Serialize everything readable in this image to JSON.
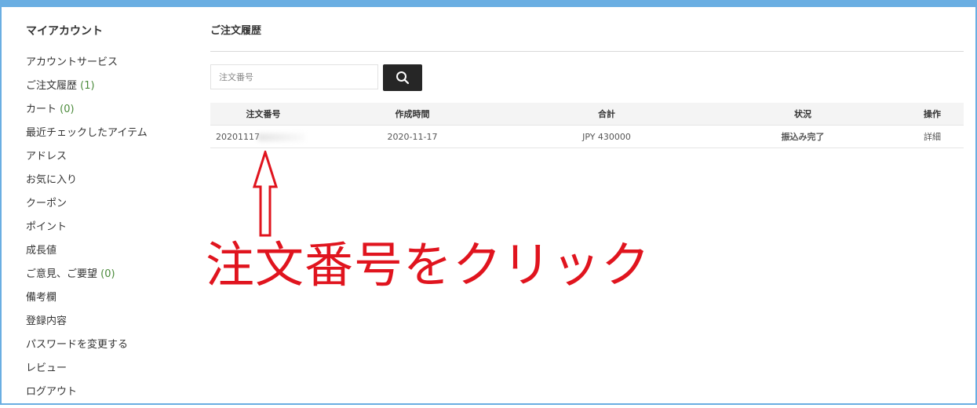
{
  "sidebar": {
    "title": "マイアカウント",
    "items": [
      {
        "label": "アカウントサービス",
        "count": ""
      },
      {
        "label": "ご注文履歴",
        "count": "(1)"
      },
      {
        "label": "カート",
        "count": "(0)"
      },
      {
        "label": "最近チェックしたアイテム",
        "count": ""
      },
      {
        "label": "アドレス",
        "count": ""
      },
      {
        "label": "お気に入り",
        "count": ""
      },
      {
        "label": "クーポン",
        "count": ""
      },
      {
        "label": "ポイント",
        "count": ""
      },
      {
        "label": "成長値",
        "count": ""
      },
      {
        "label": "ご意見、ご要望",
        "count": "(0)"
      },
      {
        "label": "備考欄",
        "count": ""
      },
      {
        "label": "登録内容",
        "count": ""
      },
      {
        "label": "パスワードを変更する",
        "count": ""
      },
      {
        "label": "レビュー",
        "count": ""
      },
      {
        "label": "ログアウト",
        "count": ""
      }
    ]
  },
  "main": {
    "title": "ご注文履歴",
    "search": {
      "placeholder": "注文番号",
      "value": ""
    },
    "table": {
      "headers": [
        "注文番号",
        "作成時間",
        "合計",
        "状況",
        "操作"
      ],
      "rows": [
        {
          "order_number": "20201117",
          "created": "2020-11-17",
          "total": "JPY 430000",
          "status": "振込み完了",
          "action": "詳細"
        }
      ]
    }
  },
  "annotation": {
    "text": "注文番号をクリック",
    "color": "#e0141e"
  },
  "colors": {
    "frame": "#6aaee2",
    "search_button": "#262626",
    "count": "#4a8a3a"
  }
}
